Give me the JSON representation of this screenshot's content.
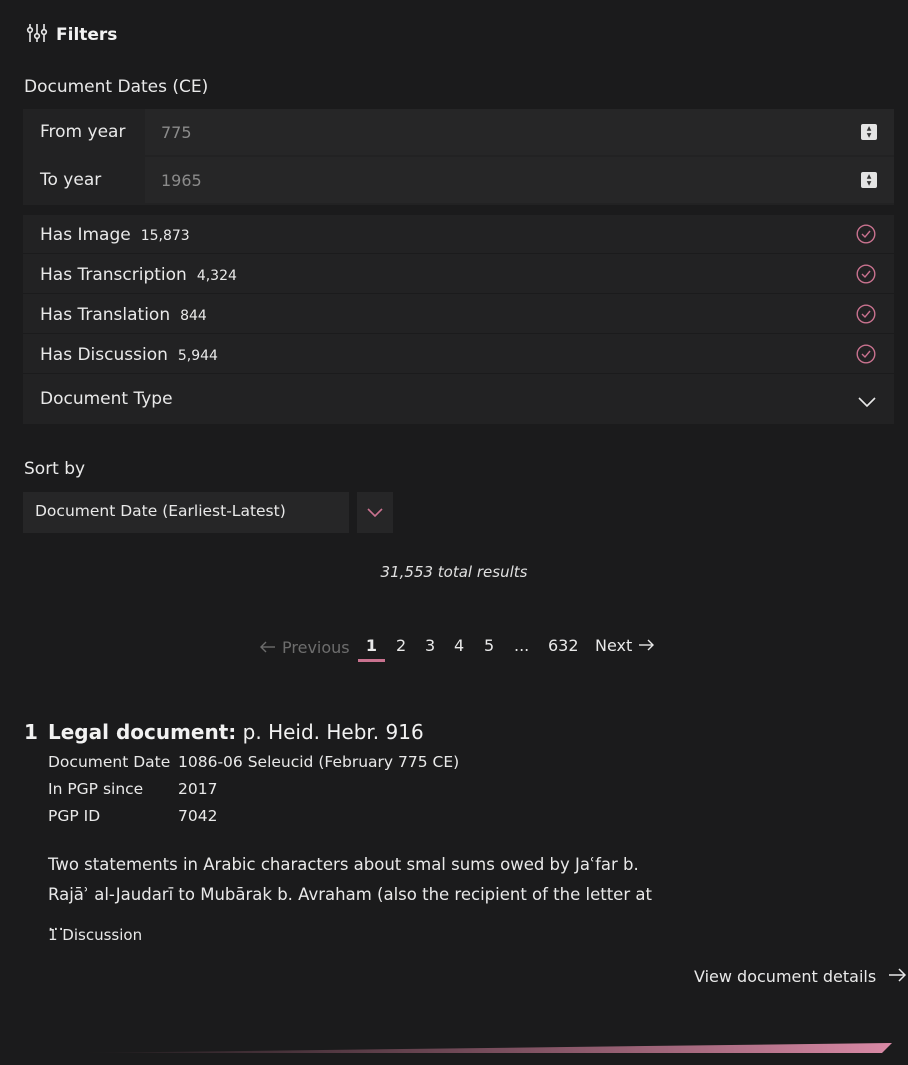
{
  "filters": {
    "title": "Filters",
    "dates_label": "Document Dates (CE)",
    "from_label": "From year",
    "from_value": "775",
    "to_label": "To year",
    "to_value": "1965",
    "checks": [
      {
        "label": "Has Image",
        "count": "15,873"
      },
      {
        "label": "Has Transcription",
        "count": "4,324"
      },
      {
        "label": "Has Translation",
        "count": "844"
      },
      {
        "label": "Has Discussion",
        "count": "5,944"
      }
    ],
    "doc_type_label": "Document Type"
  },
  "sort": {
    "label": "Sort by",
    "selected": "Document Date (Earliest-Latest)"
  },
  "results": {
    "total": "31,553 total results"
  },
  "pagination": {
    "prev": "Previous",
    "pages": [
      "1",
      "2",
      "3",
      "4",
      "5",
      "...",
      "632"
    ],
    "next": "Next"
  },
  "result": {
    "number": "1",
    "type": "Legal document:",
    "shelfmark": "p. Heid. Hebr. 916",
    "meta": [
      {
        "key": "Document Date",
        "value": "1086-06 Seleucid (February 775 CE)"
      },
      {
        "key": "In PGP since",
        "value": "2017"
      },
      {
        "key": "PGP ID",
        "value": "7042"
      }
    ],
    "description": "Two statements in Arabic characters about smal sums owed by Jaʿfar b. Rajāʾ al-Jaudarī to Mubārak b. Avraham (also the recipient of the letter at ...",
    "discussion": "1 Discussion",
    "details_link": "View document details"
  },
  "colors": {
    "background": "#1b1b1c",
    "panel": "#222223",
    "accent": "#c9728f"
  },
  "icons": [
    "sliders-icon",
    "check-circle-icon",
    "chevron-down-icon",
    "arrow-left-icon",
    "arrow-right-icon"
  ]
}
